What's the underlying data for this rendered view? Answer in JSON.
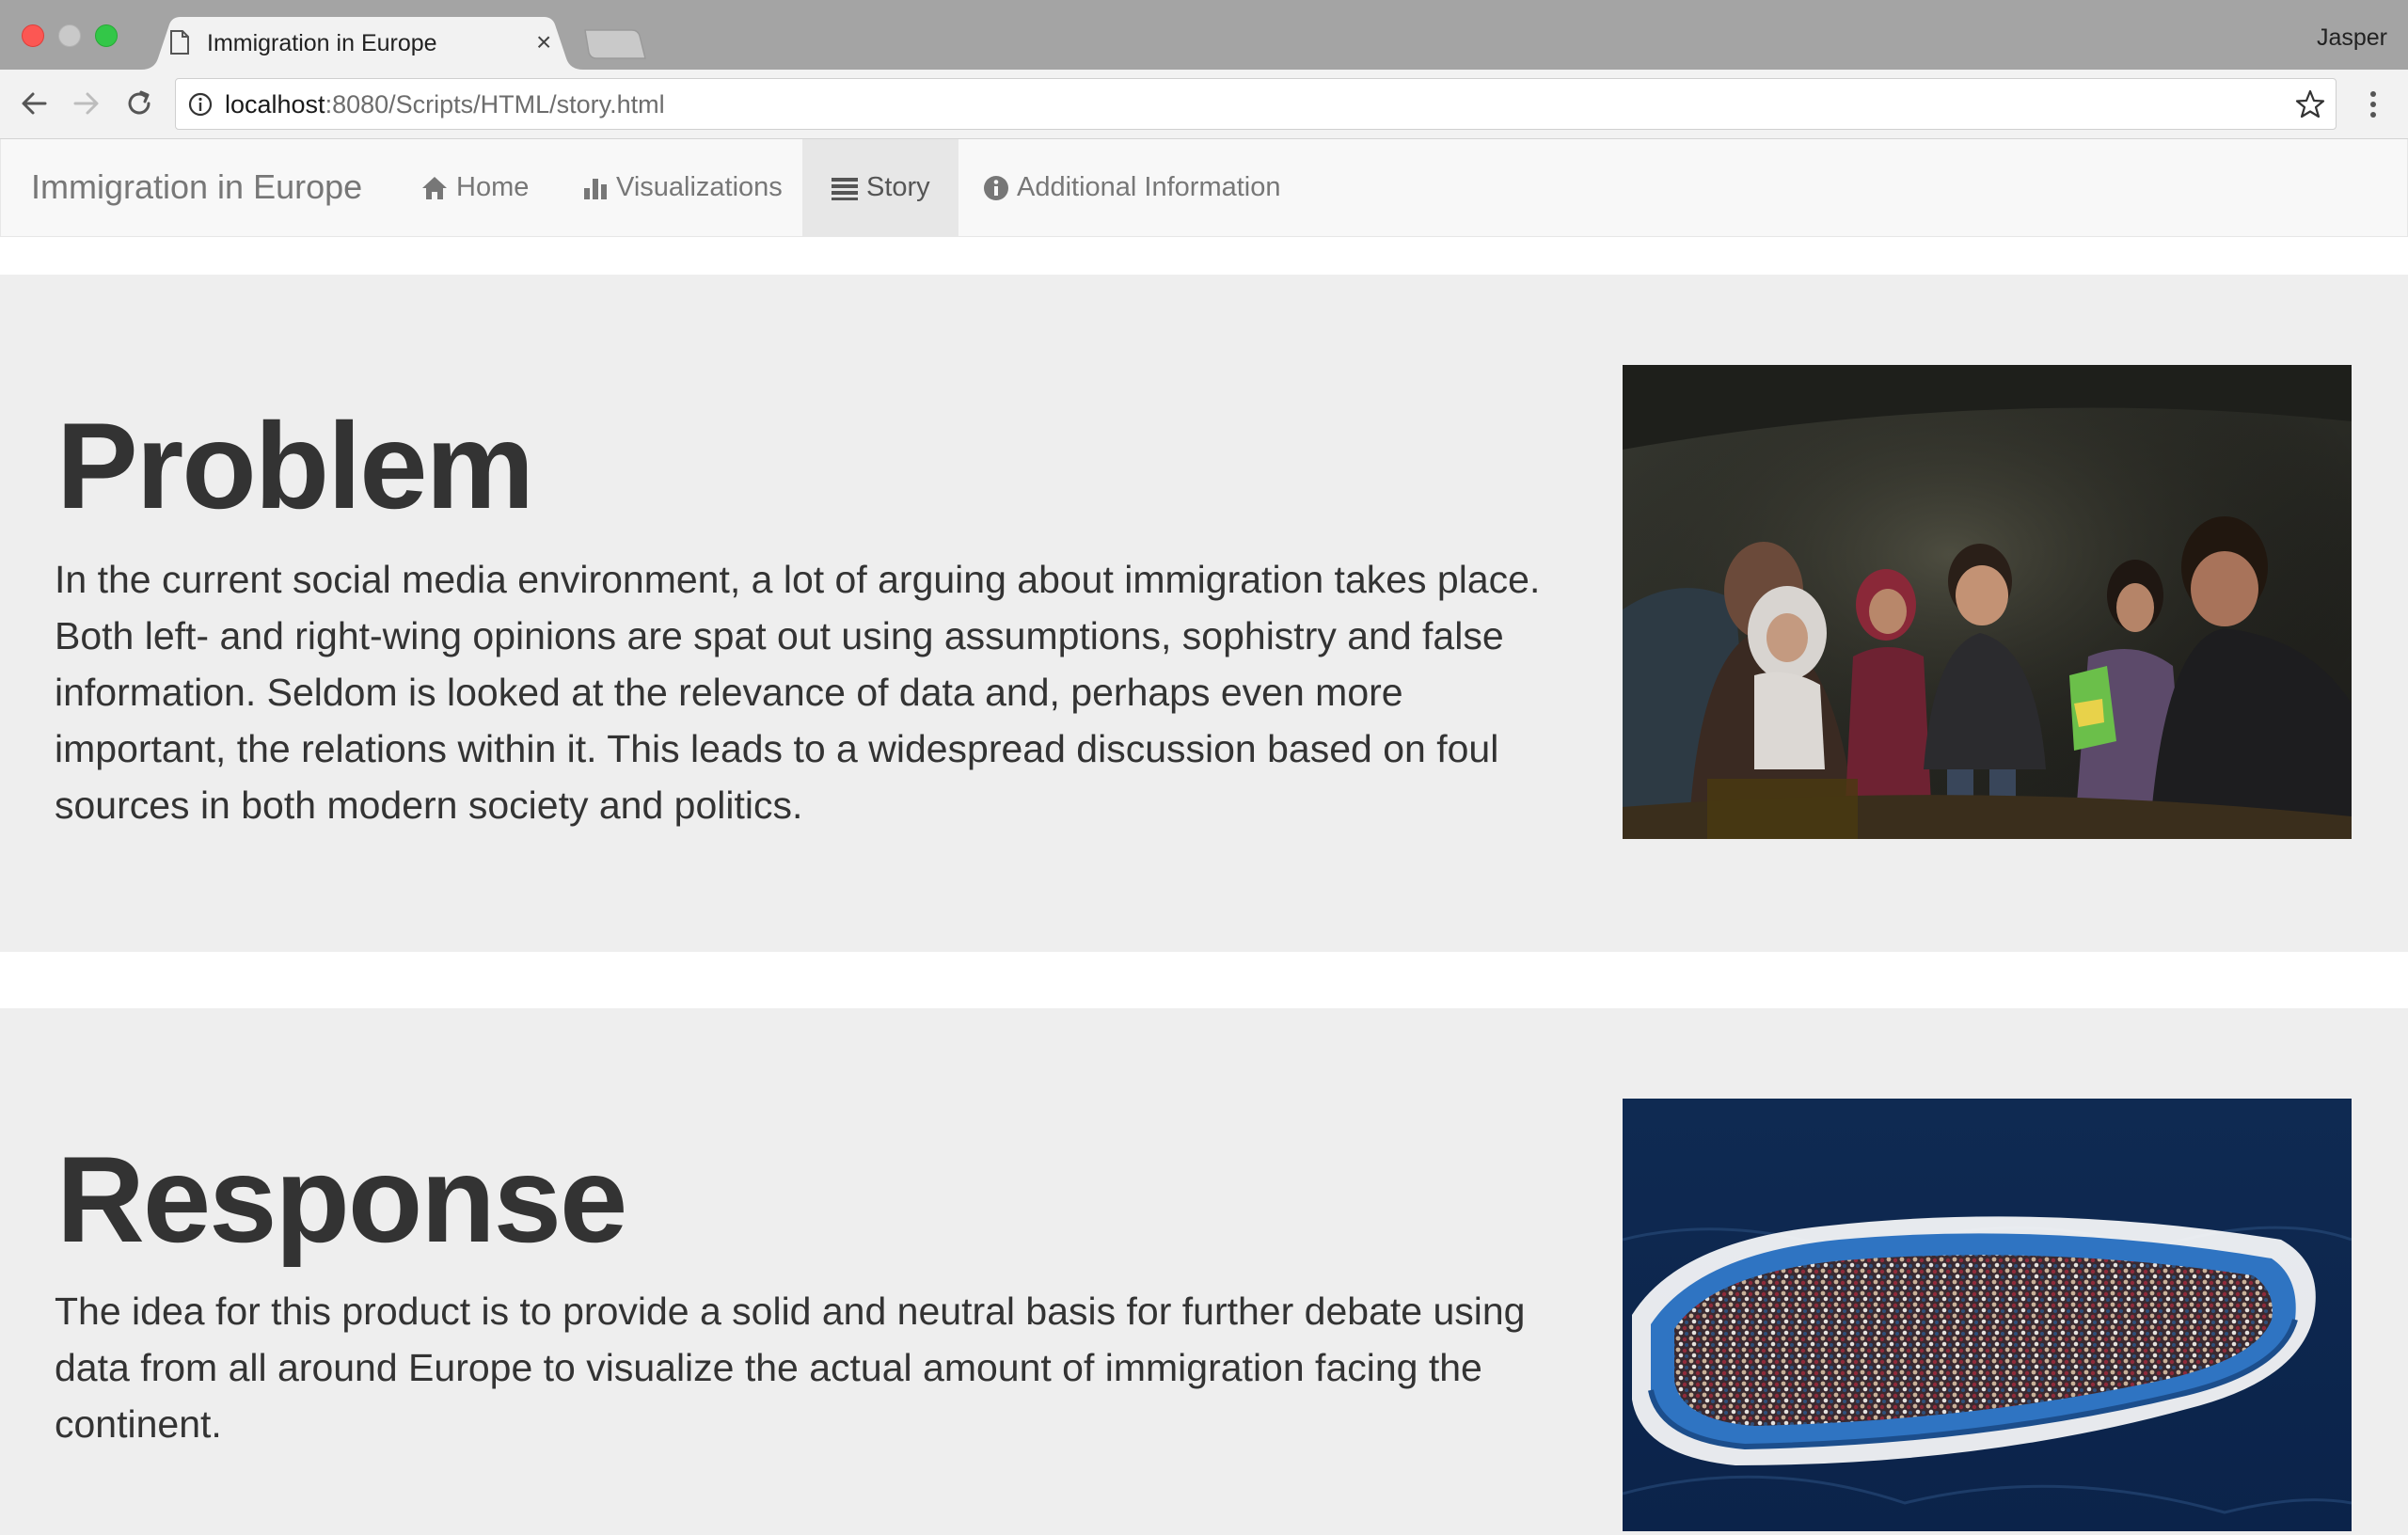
{
  "browser": {
    "tab_title": "Immigration in Europe",
    "tab_close": "×",
    "profile_name": "Jasper",
    "url_host": "localhost",
    "url_rest": ":8080/Scripts/HTML/story.html"
  },
  "navbar": {
    "brand": "Immigration in Europe",
    "items": [
      {
        "label": "Home",
        "icon": "home-icon",
        "active": false
      },
      {
        "label": "Visualizations",
        "icon": "bar-chart-icon",
        "active": false
      },
      {
        "label": "Story",
        "icon": "list-icon",
        "active": true
      },
      {
        "label": "Additional Information",
        "icon": "info-circle-icon",
        "active": false
      }
    ]
  },
  "sections": {
    "problem": {
      "heading": "Problem",
      "text": "In the current social media environment, a lot of arguing about immigration takes place. Both left- and right-wing opinions are spat out using assumptions, sophistry and false information. Seldom is looked at the relevance of data and, perhaps even more important, the relations within it. This leads to a widespread discussion based on foul sources in both modern society and politics.",
      "image": "refugee-family-photo"
    },
    "response": {
      "heading": "Response",
      "text": "The idea for this product is to provide a solid and neutral basis for further debate using data from all around Europe to visualize the actual amount of immigration facing the continent.",
      "image": "migrant-boat-aerial-photo"
    }
  },
  "colors": {
    "navbar_bg": "#f8f8f8",
    "active_nav_bg": "#e7e7e7",
    "jumbotron_bg": "#eeeeee",
    "heading_text": "#333333",
    "nav_text": "#777777"
  }
}
